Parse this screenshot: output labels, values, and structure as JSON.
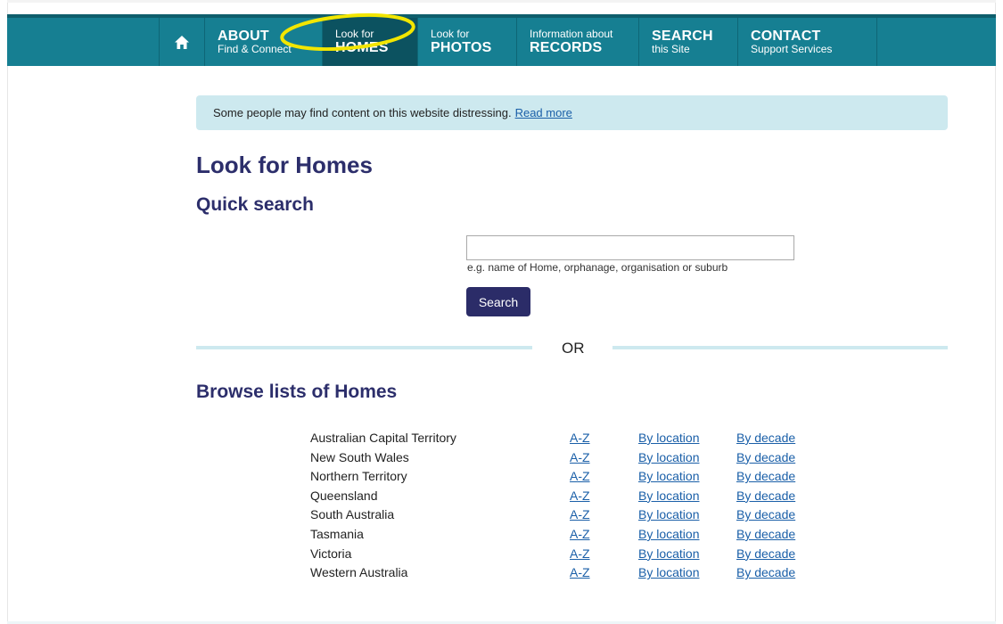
{
  "nav": {
    "items": [
      {
        "small": "Find & Connect",
        "big": "ABOUT"
      },
      {
        "small": "Look for",
        "big": "HOMES"
      },
      {
        "small": "Look for",
        "big": "PHOTOS"
      },
      {
        "small": "Information about",
        "big": "RECORDS"
      },
      {
        "small": "this Site",
        "big": "SEARCH"
      },
      {
        "small": "Support Services",
        "big": "CONTACT"
      }
    ]
  },
  "notice": {
    "text": "Some people may find content on this website distressing.",
    "link": "Read more"
  },
  "page_title": "Look for Homes",
  "quick_search": {
    "title": "Quick search",
    "input_value": "",
    "hint": "e.g. name of Home, orphanage, organisation or suburb",
    "button_label": "Search"
  },
  "or_label": "OR",
  "browse": {
    "title": "Browse lists of Homes",
    "rows": [
      {
        "state": "Australian Capital Territory",
        "az": "A-Z",
        "location": "By location",
        "decade": "By decade"
      },
      {
        "state": "New South Wales",
        "az": "A-Z",
        "location": "By location",
        "decade": "By decade"
      },
      {
        "state": "Northern Territory",
        "az": "A-Z",
        "location": "By location",
        "decade": "By decade"
      },
      {
        "state": "Queensland",
        "az": "A-Z",
        "location": "By location",
        "decade": "By decade"
      },
      {
        "state": "South Australia",
        "az": "A-Z",
        "location": "By location",
        "decade": "By decade"
      },
      {
        "state": "Tasmania",
        "az": "A-Z",
        "location": "By location",
        "decade": "By decade"
      },
      {
        "state": "Victoria",
        "az": "A-Z",
        "location": "By location",
        "decade": "By decade"
      },
      {
        "state": "Western Australia",
        "az": "A-Z",
        "location": "By location",
        "decade": "By decade"
      }
    ]
  },
  "icons": {
    "home": "home-icon"
  },
  "colors": {
    "nav_bg": "#167f92",
    "nav_active": "#0c5260",
    "heading": "#2c2e6b",
    "notice_bg": "#cde9ef",
    "link": "#1a5fa8",
    "highlight": "#f2e600"
  }
}
